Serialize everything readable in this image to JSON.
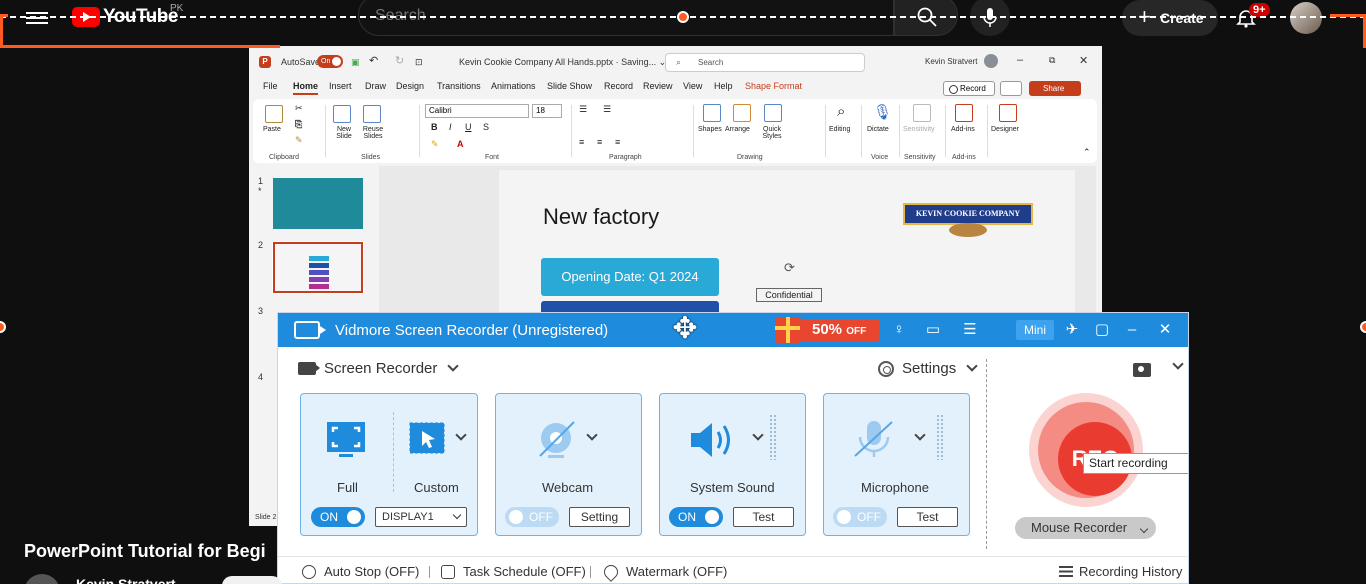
{
  "youtube": {
    "logo_text": "YouTube",
    "country": "PK",
    "search_placeholder": "Search",
    "create_label": "Create",
    "notif_badge": "9+",
    "video_title": "PowerPoint Tutorial for Begi",
    "channel": "Kevin Stratvert"
  },
  "powerpoint": {
    "autosave": "AutoSave",
    "autosave_state": "On",
    "doc_title": "Kevin Cookie Company All Hands.pptx · Saving... ⌄",
    "search_placeholder": "Search",
    "user": "Kevin Stratvert",
    "tabs": [
      "File",
      "Home",
      "Insert",
      "Draw",
      "Design",
      "Transitions",
      "Animations",
      "Slide Show",
      "Record",
      "Review",
      "View",
      "Help",
      "Shape Format"
    ],
    "record_label": "Record",
    "share_label": "Share",
    "font_name": "Calibri",
    "font_size": "18",
    "ribbon_groups": [
      "Clipboard",
      "Slides",
      "Font",
      "Paragraph",
      "Drawing",
      "Voice",
      "Sensitivity",
      "Add-ins"
    ],
    "ribbon_buttons": {
      "paste": "Paste",
      "new_slide": "New Slide",
      "reuse_slides": "Reuse Slides",
      "shapes": "Shapes",
      "arrange": "Arrange",
      "quick_styles": "Quick Styles",
      "editing": "Editing",
      "dictate": "Dictate",
      "sensitivity": "Sensitivity",
      "addins": "Add-ins",
      "designer": "Designer"
    },
    "thumb_numbers": [
      "1",
      "2",
      "3",
      "4"
    ],
    "thumb1_star": "*",
    "status": "Slide 2",
    "slide": {
      "title": "New factory",
      "opening": "Opening Date: Q1 2024",
      "logo": "KEVIN COOKIE COMPANY",
      "confidential": "Confidential"
    }
  },
  "recorder": {
    "title": "Vidmore Screen Recorder (Unregistered)",
    "promo_pct": "50%",
    "promo_off": "OFF",
    "mini_label": "Mini",
    "mode": "Screen Recorder",
    "settings_label": "Settings",
    "cards": {
      "full_label": "Full",
      "custom_label": "Custom",
      "full_toggle": "ON",
      "display": "DISPLAY1",
      "webcam_label": "Webcam",
      "webcam_toggle": "OFF",
      "webcam_btn": "Setting",
      "sound_label": "System Sound",
      "sound_toggle": "ON",
      "sound_btn": "Test",
      "mic_label": "Microphone",
      "mic_toggle": "OFF",
      "mic_btn": "Test"
    },
    "rec_label": "REC",
    "tooltip": "Start recording",
    "mouse_recorder": "Mouse Recorder",
    "footer": {
      "auto_stop": "Auto Stop (OFF)",
      "task_schedule": "Task Schedule (OFF)",
      "watermark": "Watermark (OFF)",
      "history": "Recording History"
    },
    "colors": {
      "accent": "#1e8bdc",
      "rec_red": "#ea3b31",
      "selection": "#ff5a1f"
    }
  }
}
